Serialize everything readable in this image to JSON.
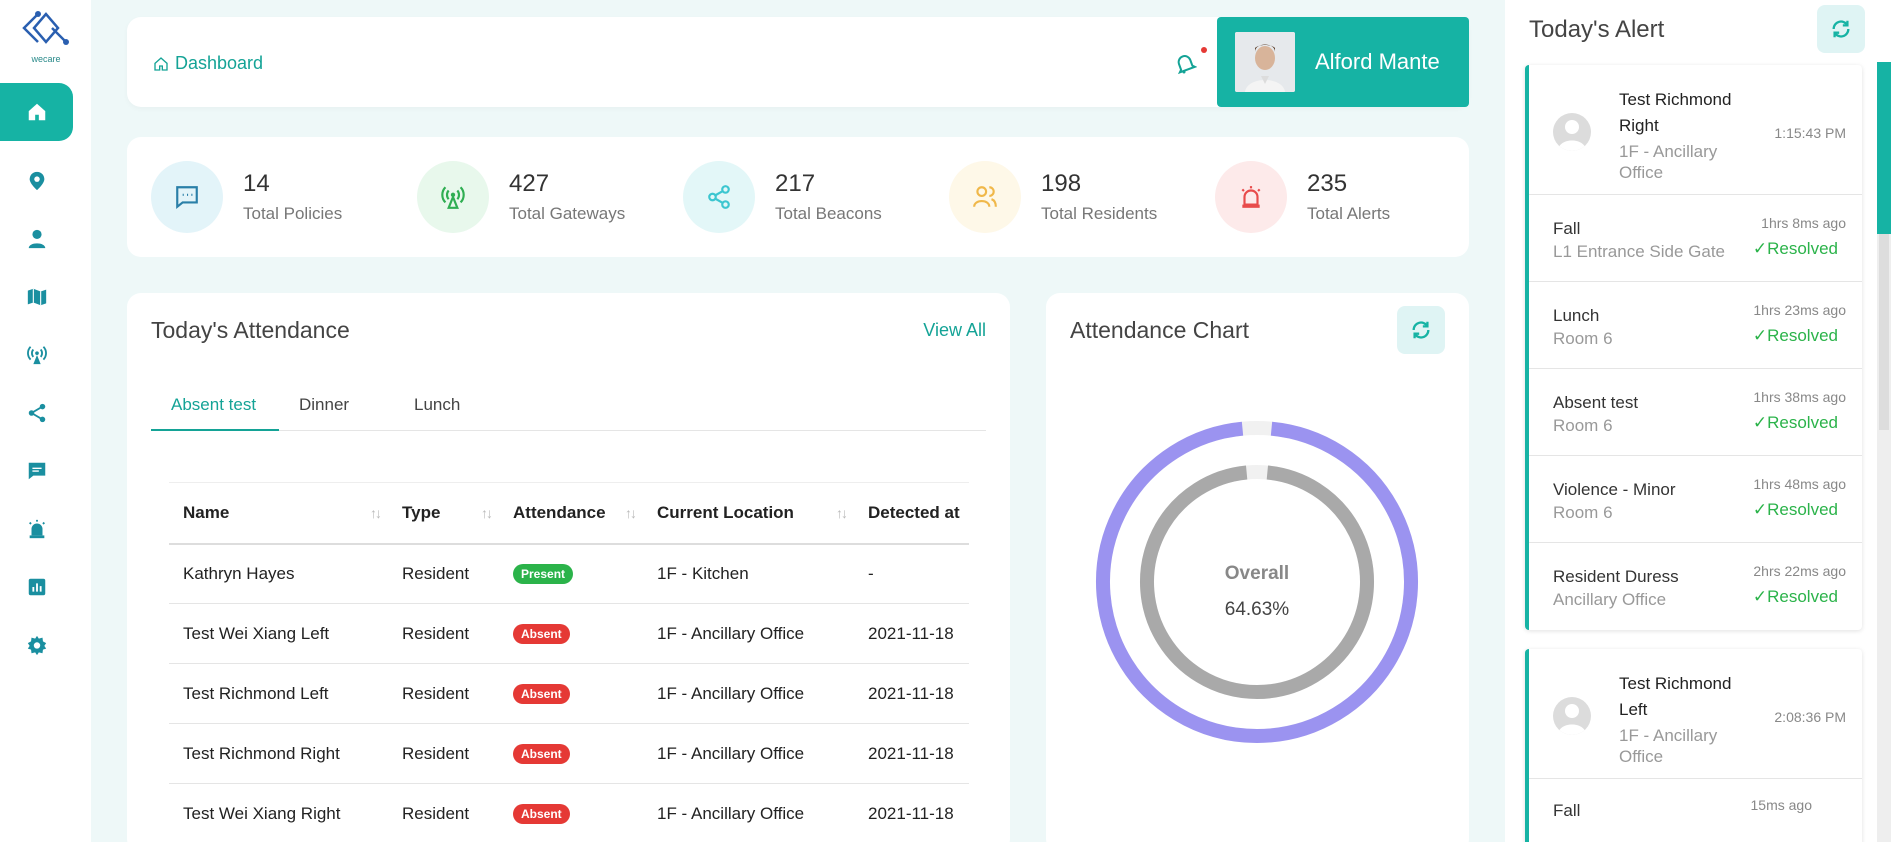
{
  "app": {
    "logo_text": "wecare"
  },
  "sidebar": {
    "items": [
      {
        "icon": "home-icon",
        "active": true
      },
      {
        "icon": "location-pin-icon"
      },
      {
        "icon": "user-icon"
      },
      {
        "icon": "map-icon"
      },
      {
        "icon": "gateway-icon"
      },
      {
        "icon": "share-icon"
      },
      {
        "icon": "message-icon"
      },
      {
        "icon": "alarm-icon"
      },
      {
        "icon": "report-icon"
      },
      {
        "icon": "gear-icon"
      }
    ]
  },
  "header": {
    "breadcrumb": "Dashboard",
    "user_name": "Alford Mante"
  },
  "stats": [
    {
      "value": "14",
      "label": "Total Policies",
      "icon": "message-icon",
      "color": "#4aa8c8",
      "bg": "#e3f4f9"
    },
    {
      "value": "427",
      "label": "Total Gateways",
      "icon": "gateway-icon",
      "color": "#3bbf5f",
      "bg": "#e8f8ec"
    },
    {
      "value": "217",
      "label": "Total Beacons",
      "icon": "share-icon",
      "color": "#3cc6d0",
      "bg": "#e3f7f8"
    },
    {
      "value": "198",
      "label": "Total Residents",
      "icon": "users-icon",
      "color": "#f0b84a",
      "bg": "#fef8e8"
    },
    {
      "value": "235",
      "label": "Total Alerts",
      "icon": "alarm-icon",
      "color": "#e84b4b",
      "bg": "#fdeaea"
    }
  ],
  "attendance": {
    "title": "Today's Attendance",
    "view_all": "View All",
    "tabs": [
      "Absent test",
      "Dinner",
      "Lunch"
    ],
    "columns": [
      "Name",
      "Type",
      "Attendance",
      "Current Location",
      "Detected at"
    ],
    "rows": [
      {
        "name": "Kathryn Hayes",
        "type": "Resident",
        "attendance": "Present",
        "location": "1F - Kitchen",
        "detected": "-"
      },
      {
        "name": "Test Wei Xiang Left",
        "type": "Resident",
        "attendance": "Absent",
        "location": "1F - Ancillary Office",
        "detected": "2021-11-18"
      },
      {
        "name": "Test Richmond Left",
        "type": "Resident",
        "attendance": "Absent",
        "location": "1F - Ancillary Office",
        "detected": "2021-11-18"
      },
      {
        "name": "Test Richmond Right",
        "type": "Resident",
        "attendance": "Absent",
        "location": "1F - Ancillary Office",
        "detected": "2021-11-18"
      },
      {
        "name": "Test Wei Xiang Right",
        "type": "Resident",
        "attendance": "Absent",
        "location": "1F - Ancillary Office",
        "detected": "2021-11-18"
      }
    ]
  },
  "chart": {
    "title": "Attendance Chart",
    "center_label": "Overall",
    "center_value": "64.63%"
  },
  "chart_data": {
    "type": "pie",
    "title": "Attendance Chart",
    "series": [
      {
        "values": [
          97,
          3
        ],
        "color": "#9b93f0"
      },
      {
        "values": [
          97,
          3
        ],
        "color": "#a9a9a9"
      }
    ]
  },
  "alerts": {
    "title": "Today's Alert",
    "groups": [
      {
        "name": "Test Richmond Right",
        "location": "1F - Ancillary Office",
        "time": "1:15:43 PM",
        "items": [
          {
            "type": "Fall",
            "sub": "L1 Entrance Side Gate",
            "ago": "1hrs 8ms ago",
            "status": "Resolved"
          },
          {
            "type": "Lunch",
            "sub": "Room 6",
            "ago": "1hrs 23ms ago",
            "status": "Resolved"
          },
          {
            "type": "Absent test",
            "sub": "Room 6",
            "ago": "1hrs 38ms ago",
            "status": "Resolved"
          },
          {
            "type": "Violence - Minor",
            "sub": "Room 6",
            "ago": "1hrs 48ms ago",
            "status": "Resolved"
          },
          {
            "type": "Resident Duress",
            "sub": "Ancillary Office",
            "ago": "2hrs 22ms ago",
            "status": "Resolved"
          }
        ]
      },
      {
        "name": "Test Richmond Left",
        "location": "1F - Ancillary Office",
        "time": "2:08:36 PM",
        "items": [
          {
            "type": "Fall",
            "sub": "",
            "ago": "15ms ago",
            "status": ""
          }
        ]
      }
    ]
  }
}
